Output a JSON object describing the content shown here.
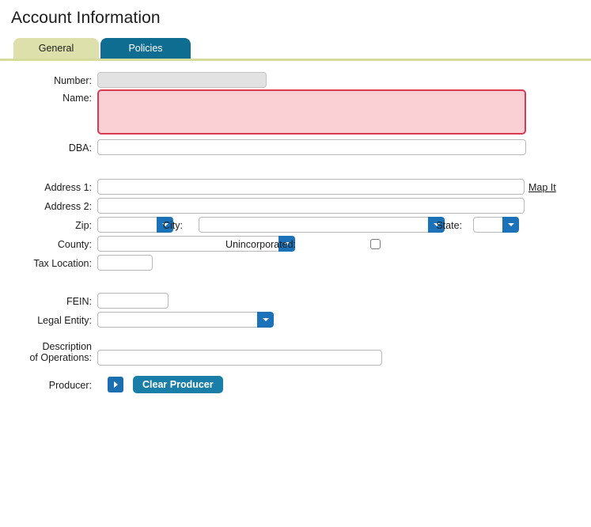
{
  "page": {
    "title": "Account Information"
  },
  "tabs": [
    {
      "label": "General",
      "selected": true
    },
    {
      "label": "Policies",
      "selected": false
    }
  ],
  "form": {
    "number": {
      "label": "Number:",
      "value": "",
      "disabled": true
    },
    "name": {
      "label": "Name:",
      "value": "",
      "invalid": true
    },
    "dba": {
      "label": "DBA:",
      "value": ""
    },
    "address1": {
      "label": "Address 1:",
      "value": ""
    },
    "address2": {
      "label": "Address 2:",
      "value": ""
    },
    "zip": {
      "label": "Zip:",
      "value": ""
    },
    "city": {
      "label": "City:",
      "value": ""
    },
    "state": {
      "label": "State:",
      "value": ""
    },
    "county": {
      "label": "County:",
      "value": ""
    },
    "unincorporated": {
      "label": "Unincorporated:",
      "checked": false
    },
    "tax_location": {
      "label": "Tax Location:",
      "value": ""
    },
    "fein": {
      "label": "FEIN:",
      "value": ""
    },
    "legal_entity": {
      "label": "Legal Entity:",
      "value": ""
    },
    "description_of_operations": {
      "label_line1": "Description",
      "label_line2": "of Operations:",
      "value": ""
    },
    "producer": {
      "label": "Producer:"
    }
  },
  "links": {
    "map_it": "Map It"
  },
  "buttons": {
    "producer_expand": "producer-expand",
    "clear_producer": "Clear Producer"
  },
  "colors": {
    "tab_active": "#dde0ab",
    "tab_inactive": "#106d92",
    "rule": "#d5dc9b",
    "error_bg": "#fbd0d4",
    "error_border": "#d93a52",
    "disabled_bg": "#e2e2e2",
    "combo_button": "#1b72b8",
    "primary_button": "#1a7fa8"
  }
}
